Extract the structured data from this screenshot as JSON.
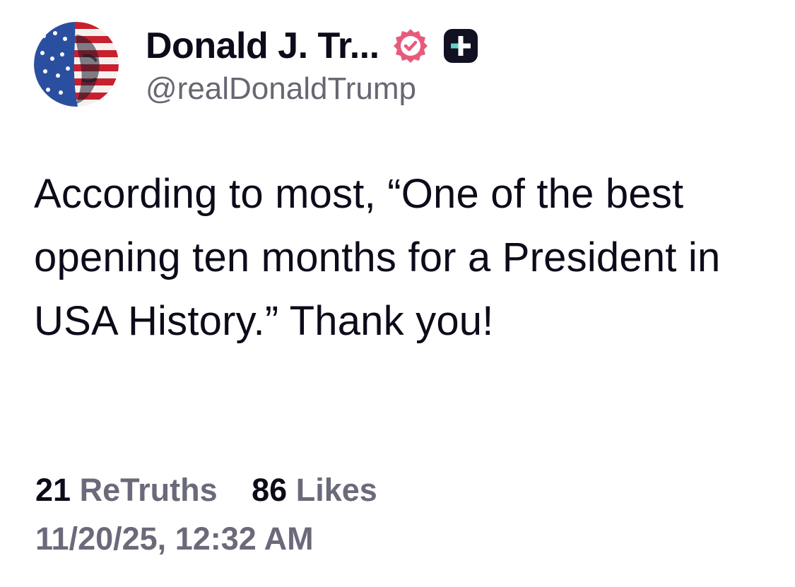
{
  "post": {
    "author": {
      "display_name": "Donald J. Tr...",
      "handle": "@realDonaldTrump",
      "avatar": "flag-portrait-avatar",
      "verified_icon": "verified-badge-icon",
      "plus_icon": "plus-badge-icon"
    },
    "body": "According to most, “One of the best opening ten months for a President in USA History.” Thank you!",
    "stats": {
      "retruths_count": "21",
      "retruths_label": "ReTruths",
      "likes_count": "86",
      "likes_label": "Likes"
    },
    "timestamp": "11/20/25, 12:32 AM"
  },
  "colors": {
    "text_primary": "#0b0b1a",
    "text_secondary": "#6a6a7a",
    "verified_pink": "#e85a7c",
    "plus_badge_bg": "#111122",
    "plus_accent": "#5fd3c2"
  }
}
